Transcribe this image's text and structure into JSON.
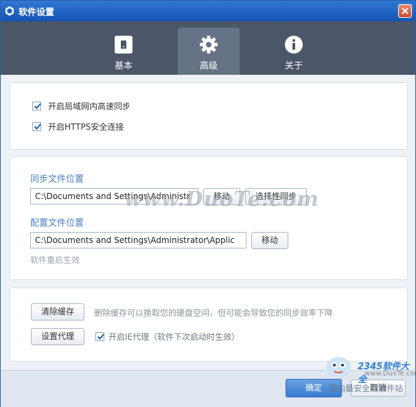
{
  "window": {
    "title": "软件设置"
  },
  "tabs": [
    {
      "label": "基本",
      "icon": "phone-icon"
    },
    {
      "label": "高级",
      "icon": "gear-icon"
    },
    {
      "label": "关于",
      "icon": "info-icon"
    }
  ],
  "sync": {
    "lan_sync_label": "开启局域网内高速同步",
    "https_label": "开启HTTPS安全连接"
  },
  "sync_folder": {
    "title": "同步文件位置",
    "path": "C:\\Documents and Settings\\Administr",
    "move_label": "移动",
    "selective_label": "选择性同步"
  },
  "config_folder": {
    "title": "配置文件位置",
    "path": "C:\\Documents and Settings\\Administrator\\Applic",
    "move_label": "移动",
    "hint": "软件重启生效"
  },
  "cache": {
    "clear_label": "清除缓存",
    "clear_desc": "删除缓存可以换取您的硬盘空间，但可能会导致您的同步效率下降"
  },
  "proxy": {
    "set_label": "设置代理",
    "ie_proxy_label": "开启IE代理（软件下次启动时生效）"
  },
  "footer": {
    "ok_label": "确定",
    "cancel_label": "取消"
  },
  "watermark": {
    "center": "www.DuoTe.com",
    "logo": "2345软件大全",
    "url": "www.DuoTe.com",
    "bottom": "国内最安全的软件站"
  },
  "colors": {
    "titlebar": "#1f64c0",
    "tabbar": "#4b5768",
    "active_tab": "#667386",
    "accent": "#3a7bcf"
  }
}
